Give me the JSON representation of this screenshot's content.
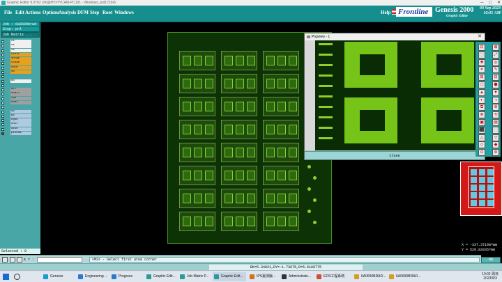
{
  "window": {
    "title": "Graphic Editor 9.07b2 (X6@HY-HYCAM-PC101 - Windows_pid17324)"
  },
  "menu": [
    {
      "label": "File"
    },
    {
      "label": "Edit"
    },
    {
      "label": "Actions"
    },
    {
      "label": "Options"
    },
    {
      "label": "Analysis"
    },
    {
      "label": "DFM"
    },
    {
      "label": "Step"
    },
    {
      "label": "Root"
    },
    {
      "label": "Windows"
    },
    {
      "label": "Help"
    }
  ],
  "brand": {
    "logo": "Frontline",
    "product": "Genesis 2000",
    "subtitle": "Graphic Editor"
  },
  "datetime": {
    "date": "03 Sep 2023",
    "time": "10:01 AM"
  },
  "job": {
    "job_label": "Job : 6a0690brad",
    "step_label": "Step: pnl",
    "matrix_label": "Job Matrix ..."
  },
  "layers": [
    {
      "name": "cs",
      "color": "#f0f0f0"
    },
    {
      "name": "ss",
      "color": "#f0f0f0"
    },
    {
      "name": "ss",
      "color": "#f0f0f0"
    },
    {
      "name": "slnft",
      "color": "#e8a020"
    },
    {
      "name": "sntgb",
      "color": "#e8a020"
    },
    {
      "name": "sldab",
      "color": "#e8a020"
    },
    {
      "name": "sntb",
      "color": "#e8a020"
    },
    {
      "name": "ss",
      "color": "#e8a020"
    },
    {
      "name": "",
      "color": "#49a6a6"
    },
    {
      "name": "bo",
      "color": "#f0f0f0"
    },
    {
      "name": "",
      "color": "#49a6a6"
    },
    {
      "name": "drl",
      "color": "#a0a0a0"
    },
    {
      "name": "sndrl",
      "color": "#a0a0a0"
    },
    {
      "name": "fpd",
      "color": "#a0a0a0"
    },
    {
      "name": "cout",
      "color": "#a0a0a0"
    },
    {
      "name": "",
      "color": "#49a6a6"
    },
    {
      "name": "tp",
      "color": "#b0c8e0"
    },
    {
      "name": "bp",
      "color": "#b0c8e0"
    },
    {
      "name": "ngsh",
      "color": "#b0c8e0"
    },
    {
      "name": "dhst",
      "color": "#b0c8e0"
    },
    {
      "name": "dzsh",
      "color": "#b0c8e0"
    },
    {
      "name": "pthosm",
      "color": "#b0c8e0"
    }
  ],
  "selected": "Selected : 0",
  "popview": {
    "title": "Popview - 1",
    "close_label": "Close"
  },
  "coords": {
    "x": "X = -337.37198?mm",
    "y": "Y = 529.82835?mm"
  },
  "nn_label": "NN",
  "command": {
    "xy_label": "X Y :",
    "input_value": "",
    "message": "<M3> - Select first area corner"
  },
  "status": {
    "text": "BK=5.34821,DY=-1.73675,D=5.6169775"
  },
  "taskbar": [
    {
      "label": "Genesis",
      "color": "#1a9ad0"
    },
    {
      "label": "Engineering ...",
      "color": "#2a7ad0"
    },
    {
      "label": "Progress",
      "color": "#2a7ad0"
    },
    {
      "label": "Graphic Edit...",
      "color": "#2a9a9a"
    },
    {
      "label": "Job Matrix P...",
      "color": "#2a9a9a"
    },
    {
      "label": "Graphic Edit...",
      "color": "#2a9a9a"
    },
    {
      "label": "IPS嘉测版...",
      "color": "#d07020"
    },
    {
      "label": "Administrato...",
      "color": "#333333"
    },
    {
      "label": "EDS工程系统",
      "color": "#d05030"
    },
    {
      "label": "6A0690BRAD...",
      "color": "#d0a020"
    },
    {
      "label": "6A0690BRAD...",
      "color": "#d0a020"
    }
  ],
  "clock": {
    "time": "10:02 周日",
    "date": "2023/9/3"
  }
}
